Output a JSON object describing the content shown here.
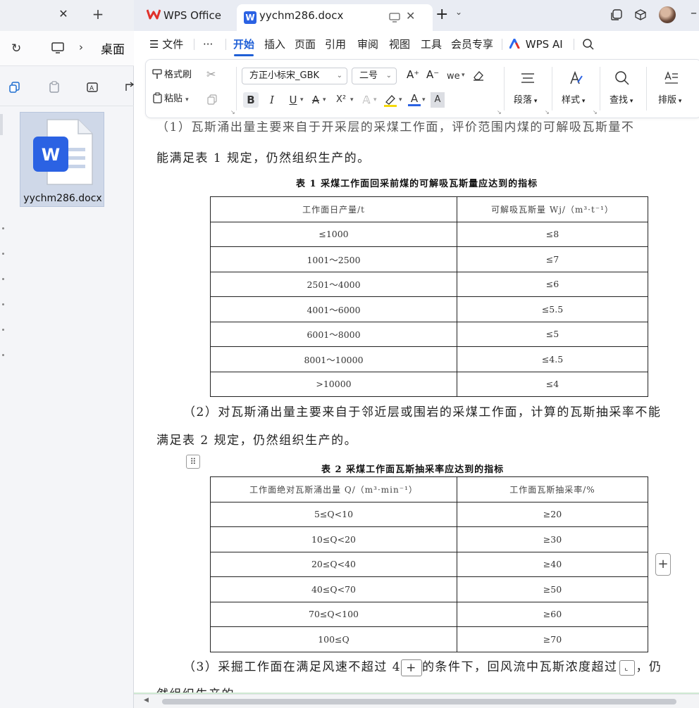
{
  "explorer": {
    "address_location": "桌面",
    "file_name": "yychm286.docx",
    "file_badge": "W"
  },
  "wps": {
    "tabs": [
      {
        "label": "WPS Office"
      },
      {
        "label": "yychm286.docx",
        "badge": "W"
      }
    ],
    "menu": {
      "hamburger": "☰ 文件",
      "more": "···",
      "items": [
        "开始",
        "插入",
        "页面",
        "引用",
        "审阅",
        "视图",
        "工具",
        "会员专享"
      ],
      "active": "开始",
      "ai": "WPS AI"
    },
    "ribbon": {
      "format_painter": "格式刷",
      "paste": "粘贴",
      "font_name": "方正小标宋_GBK",
      "font_size": "二号",
      "paragraph": "段落",
      "styles": "样式",
      "find": "查找",
      "layout": "排版",
      "bold": "B",
      "italic": "I",
      "underline": "U",
      "strike": "A",
      "superscript": "X²",
      "font_color": "A",
      "char_shade": "A",
      "grow": "A⁺",
      "shrink": "A⁻",
      "phonetic": "wen"
    },
    "colors": {
      "accent": "#1f5fd6",
      "wps_red": "#e0312b",
      "doc_blue": "#2b62e3"
    }
  },
  "document": {
    "cut_line": "（1）瓦斯涌出量主要来自于开采层的采煤工作面，评价范围内煤的可解吸瓦斯量不",
    "para1_tail": "能满足表 1 规定，仍然组织生产的。",
    "table1": {
      "caption": "表 1  采煤工作面回采前煤的可解吸瓦斯量应达到的指标",
      "headers": [
        "工作面日产量/t",
        "可解吸瓦斯量 Wj/（m³·t⁻¹）"
      ],
      "rows": [
        [
          "≤1000",
          "≤8"
        ],
        [
          "1001～2500",
          "≤7"
        ],
        [
          "2501～4000",
          "≤6"
        ],
        [
          "4001～6000",
          "≤5.5"
        ],
        [
          "6001～8000",
          "≤5"
        ],
        [
          "8001～10000",
          "≤4.5"
        ],
        [
          ">10000",
          "≤4"
        ]
      ]
    },
    "para2_line1": "（2）对瓦斯涌出量主要来自于邻近层或围岩的采煤工作面，计算的瓦斯抽采率不能",
    "para2_line2": "满足表 2 规定，仍然组织生产的。",
    "table2": {
      "caption": "表 2    采煤工作面瓦斯抽采率应达到的指标",
      "headers": [
        "工作面绝对瓦斯涌出量 Q/（m³·min⁻¹）",
        "工作面瓦斯抽采率/%"
      ],
      "rows": [
        [
          "5≤Q<10",
          "≥20"
        ],
        [
          "10≤Q<20",
          "≥30"
        ],
        [
          "20≤Q<40",
          "≥40"
        ],
        [
          "40≤Q<70",
          "≥50"
        ],
        [
          "70≤Q<100",
          "≥60"
        ],
        [
          "100≤Q",
          "≥70"
        ]
      ]
    },
    "para3_a": "（3）采掘工作面在满足风速不超过 4",
    "para3_b": "的条件下，回风流中瓦斯浓度超过",
    "para3_c": "，仍",
    "para3_tail": "然组织生产的。",
    "handle_glyph": "⠿",
    "plus_glyph": "+"
  }
}
